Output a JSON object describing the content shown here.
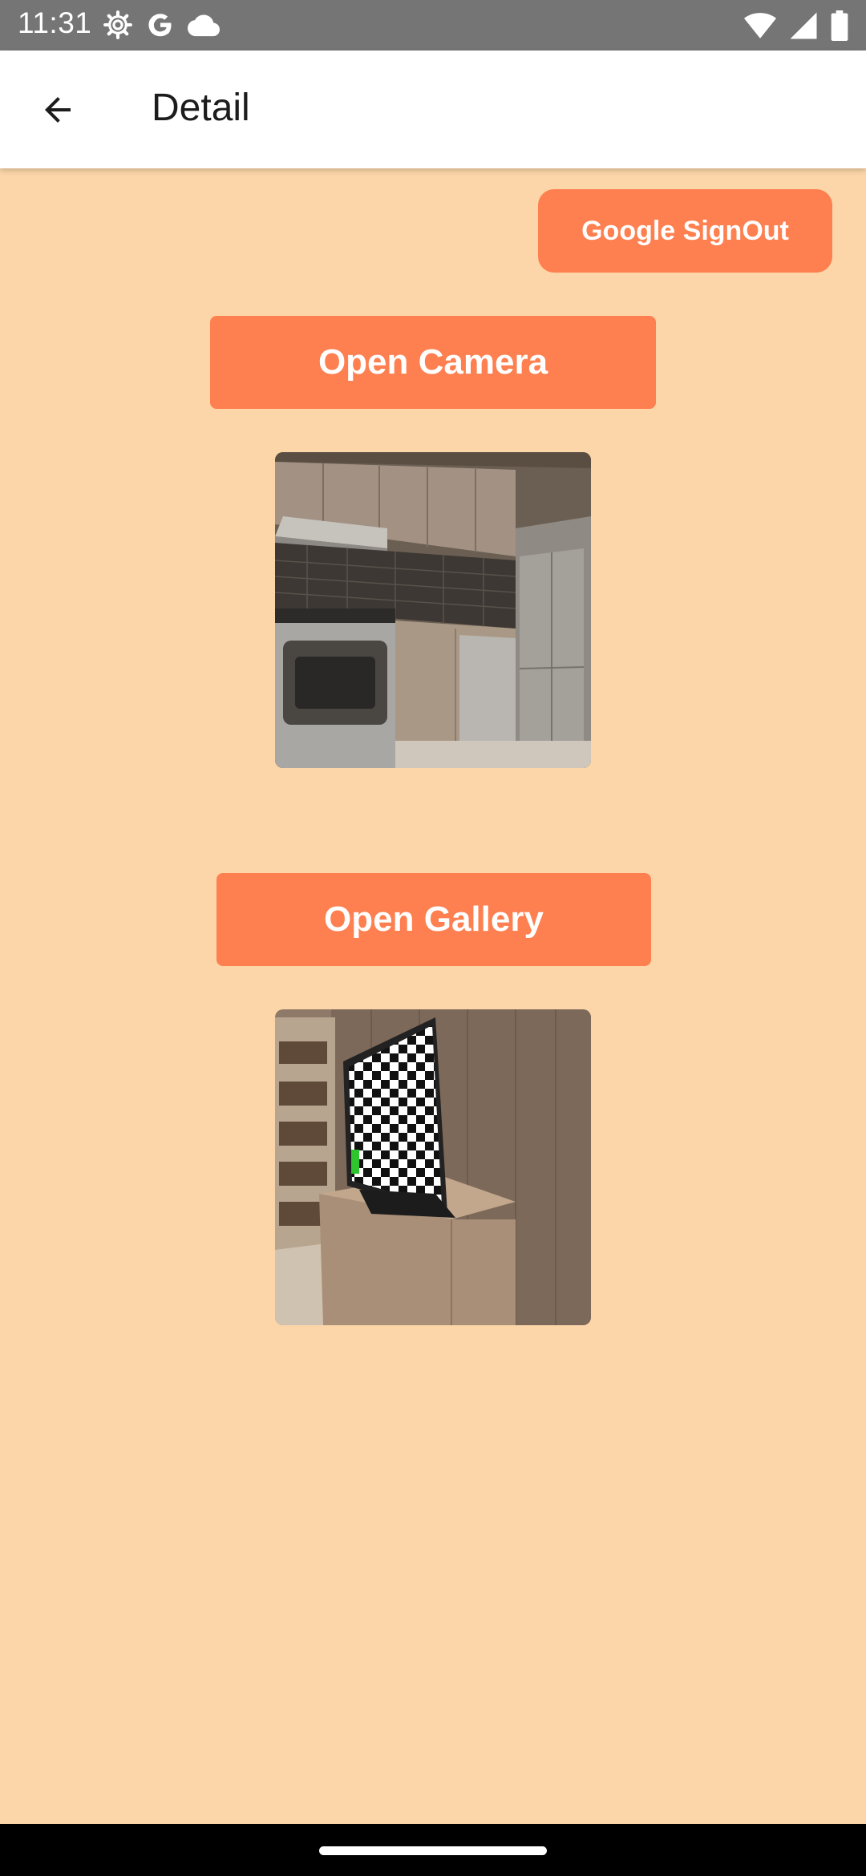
{
  "status_bar": {
    "time": "11:31",
    "left_icons": [
      "settings-icon",
      "google-icon",
      "cloud-icon"
    ],
    "right_icons": [
      "wifi-icon",
      "signal-icon",
      "battery-icon"
    ]
  },
  "app_bar": {
    "back_icon": "arrow-back-icon",
    "title": "Detail"
  },
  "main": {
    "signout_label": "Google SignOut",
    "camera_label": "Open Camera",
    "gallery_label": "Open Gallery",
    "camera_image": "kitchen photo",
    "gallery_image": "tv room photo"
  },
  "colors": {
    "background": "#fcd6a8",
    "accent": "#fe7f4f",
    "app_bar": "#ffffff",
    "status_bar": "#757575"
  }
}
